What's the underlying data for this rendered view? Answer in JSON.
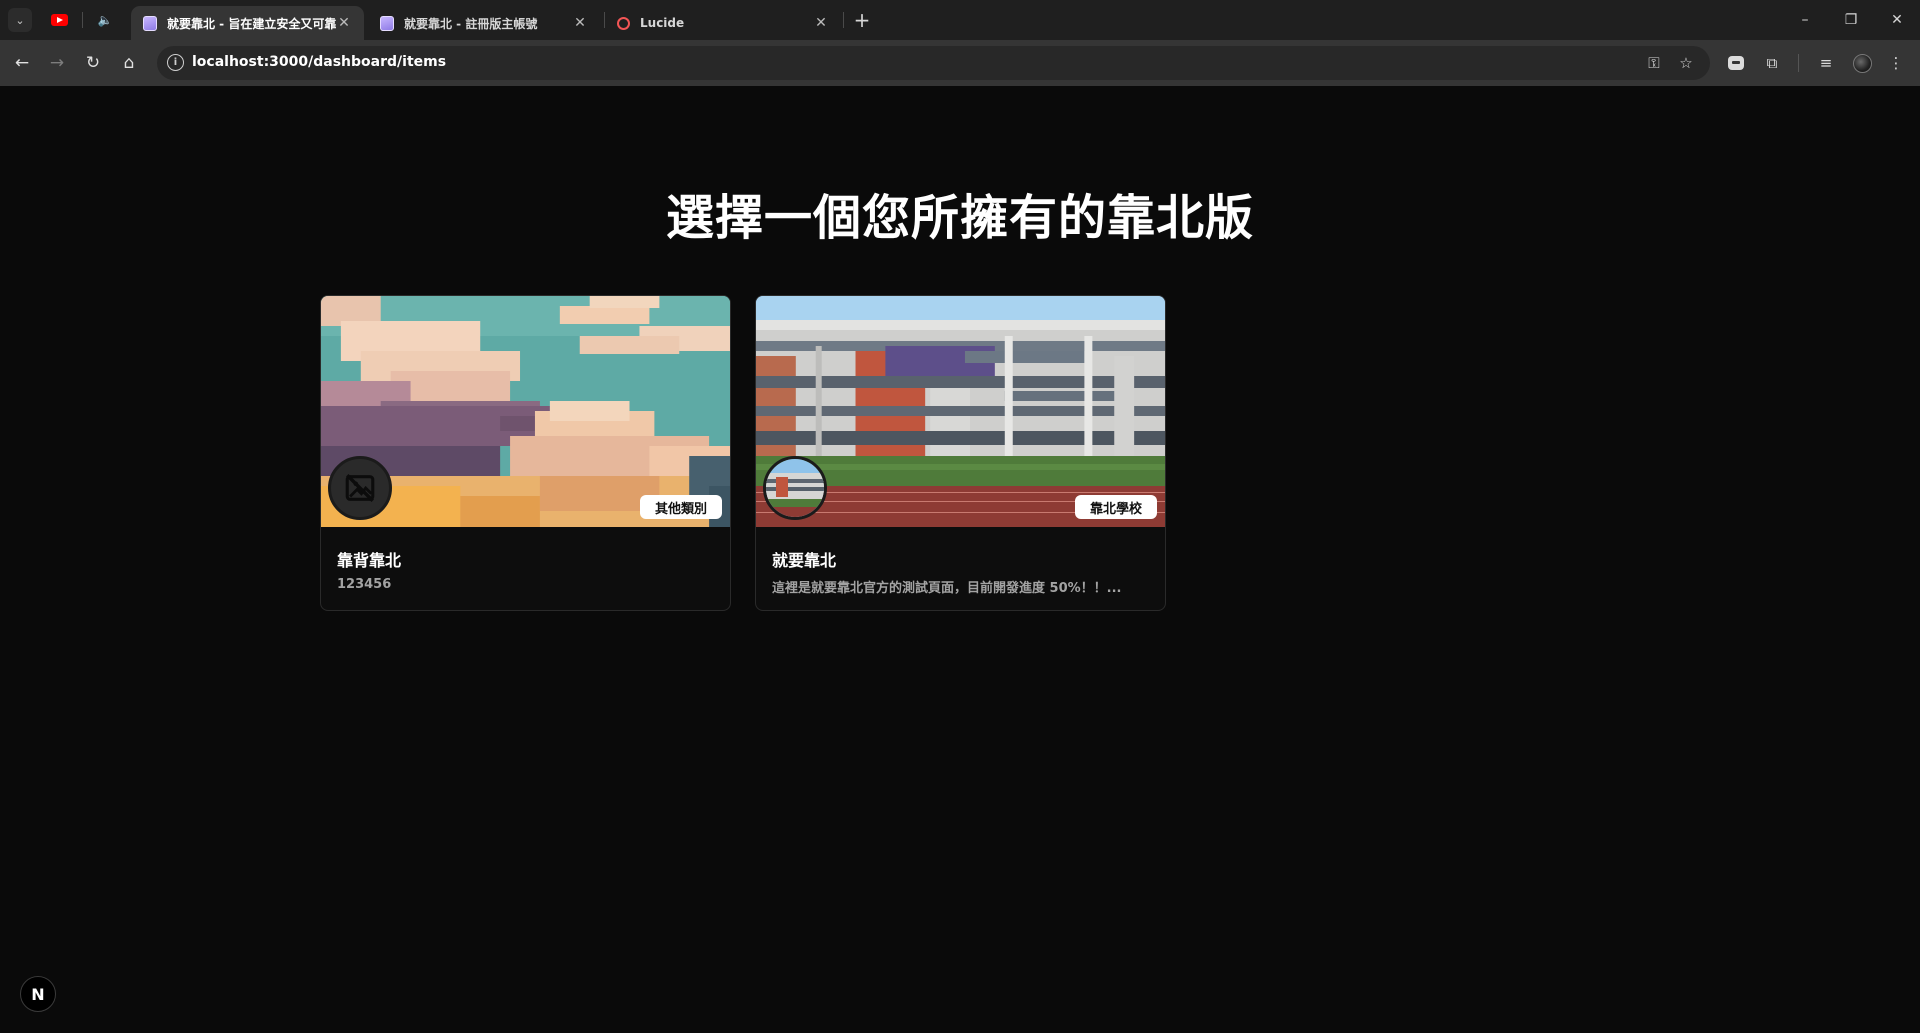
{
  "browser": {
    "tabs": [
      {
        "title": "就要靠北 - 旨在建立安全又可靠",
        "active": true
      },
      {
        "title": "就要靠北 - 註冊版主帳號",
        "active": false
      },
      {
        "title": "Lucide",
        "active": false
      }
    ],
    "url": "localhost:3000/dashboard/items",
    "icons": {
      "back": "←",
      "forward": "→",
      "reload": "↻",
      "home": "⌂",
      "key": "⚿",
      "star": "☆",
      "close": "✕",
      "new_tab": "+",
      "minimize": "–",
      "restore": "❐",
      "menu": "⋮",
      "tab_search": "⌄",
      "volume": "🔈",
      "extensions": "⧉",
      "media": "≡"
    }
  },
  "page": {
    "title": "選擇一個您所擁有的靠北版"
  },
  "boards": [
    {
      "name": "靠背靠北",
      "description": "123456",
      "category": "其他類別",
      "cover": "pixel-sky",
      "avatar": "no-image"
    },
    {
      "name": "就要靠北",
      "description": "這裡是就要靠北官方的測試頁面，目前開發進度 50%！！...",
      "category": "靠北學校",
      "cover": "school-building",
      "avatar": "school-building"
    }
  ],
  "nextjs_badge": "N",
  "colors": {
    "page_bg": "#0a0a0a",
    "tabstrip_bg": "#1f1f1f",
    "toolbar_bg": "#353535",
    "badge_bg": "#ffffff"
  }
}
